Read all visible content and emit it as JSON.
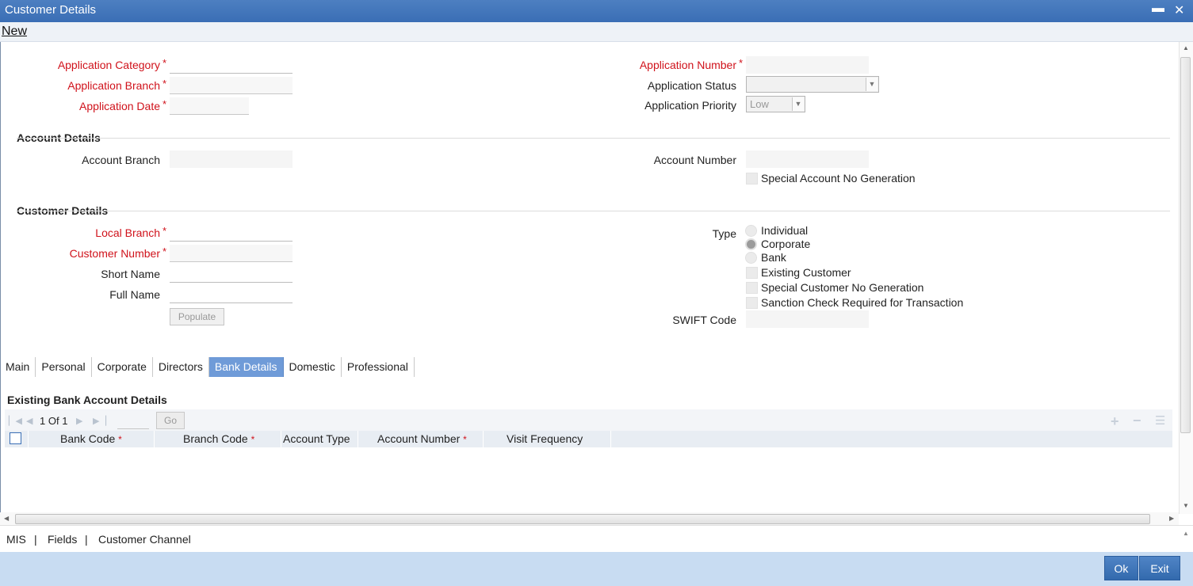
{
  "window": {
    "title": "Customer Details",
    "minimize_glyph": "▬",
    "close_glyph": "✕"
  },
  "toolbar": {
    "new_label": "New"
  },
  "application": {
    "category_label": "Application Category",
    "branch_label": "Application Branch",
    "date_label": "Application Date",
    "number_label": "Application Number",
    "status_label": "Application Status",
    "status_value": "",
    "priority_label": "Application Priority",
    "priority_value": "Low",
    "required_marker": "*"
  },
  "account": {
    "section_title": "Account Details",
    "branch_label": "Account Branch",
    "number_label": "Account Number",
    "special_no_label": "Special Account No Generation"
  },
  "customer": {
    "section_title": "Customer Details",
    "local_branch_label": "Local Branch",
    "customer_number_label": "Customer Number",
    "short_name_label": "Short Name",
    "full_name_label": "Full Name",
    "populate_label": "Populate",
    "type_label": "Type",
    "type_options": [
      "Individual",
      "Corporate",
      "Bank"
    ],
    "type_selected": "Corporate",
    "existing_customer_label": "Existing Customer",
    "special_customer_no_label": "Special Customer No Generation",
    "sanction_check_label": "Sanction Check Required for Transaction",
    "swift_label": "SWIFT Code"
  },
  "tabs": [
    {
      "label": "Main",
      "active": false
    },
    {
      "label": "Personal",
      "active": false
    },
    {
      "label": "Corporate",
      "active": false
    },
    {
      "label": "Directors",
      "active": false
    },
    {
      "label": "Bank Details",
      "active": true
    },
    {
      "label": "Domestic",
      "active": false
    },
    {
      "label": "Professional",
      "active": false
    }
  ],
  "bank_details": {
    "section_title": "Existing Bank Account Details",
    "pager": {
      "current": "1",
      "of_label": "Of",
      "total": "1",
      "go_label": "Go"
    },
    "columns": [
      {
        "label": "Bank Code",
        "required": true
      },
      {
        "label": "Branch Code",
        "required": true
      },
      {
        "label": "Account Type",
        "required": false
      },
      {
        "label": "Account Number",
        "required": true
      },
      {
        "label": "Visit Frequency",
        "required": false
      }
    ]
  },
  "footer": {
    "links": [
      "MIS",
      "Fields",
      "Customer Channel"
    ],
    "separator": "|",
    "ok_label": "Ok",
    "exit_label": "Exit"
  },
  "colors": {
    "title_bar": "#3a6eb5",
    "required_text": "#d0121b",
    "active_tab": "#6f9bd8",
    "footer_band": "#c8dcf2",
    "primary_button": "#336aad"
  }
}
